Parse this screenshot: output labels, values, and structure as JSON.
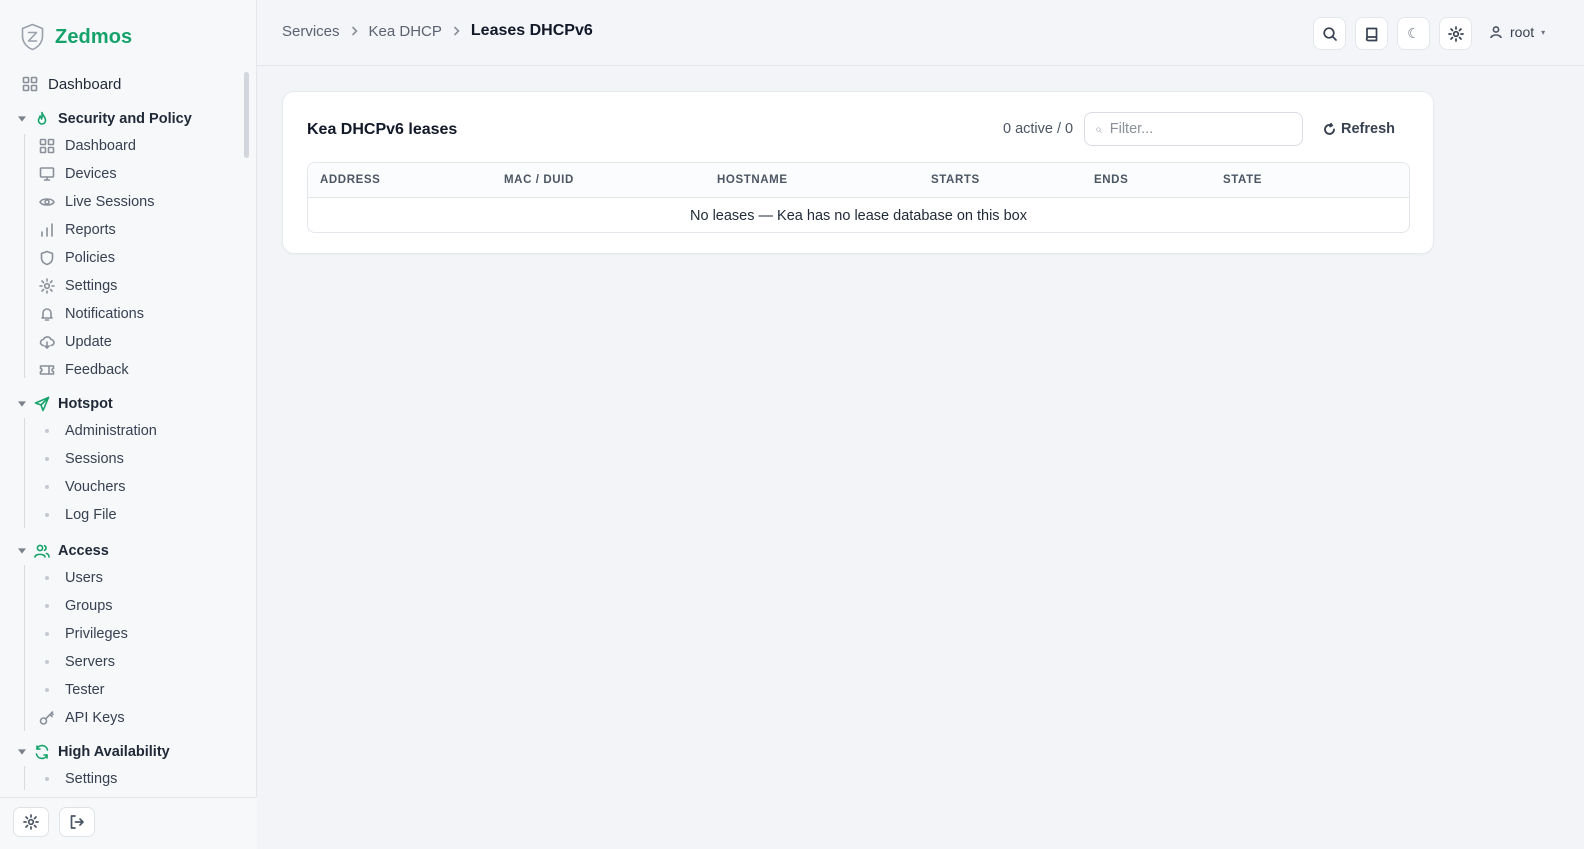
{
  "brand": {
    "name": "Zedmos"
  },
  "sidebar": {
    "top_item": "Dashboard",
    "groups": [
      {
        "title": "Security and Policy",
        "items": [
          "Dashboard",
          "Devices",
          "Live Sessions",
          "Reports",
          "Policies",
          "Settings",
          "Notifications",
          "Update",
          "Feedback"
        ]
      },
      {
        "title": "Hotspot",
        "items": [
          "Administration",
          "Sessions",
          "Vouchers",
          "Log File"
        ]
      },
      {
        "title": "Access",
        "items": [
          "Users",
          "Groups",
          "Privileges",
          "Servers",
          "Tester",
          "API Keys"
        ]
      },
      {
        "title": "High Availability",
        "items": [
          "Settings"
        ]
      }
    ]
  },
  "breadcrumb": {
    "items": [
      "Services",
      "Kea DHCP"
    ],
    "current": "Leases DHCPv6"
  },
  "header": {
    "user": "root"
  },
  "card": {
    "title": "Kea DHCPv6 leases",
    "count": "0 active / 0",
    "filter_placeholder": "Filter...",
    "refresh_label": "Refresh",
    "columns": [
      "ADDRESS",
      "MAC / DUID",
      "HOSTNAME",
      "STARTS",
      "ENDS",
      "STATE"
    ],
    "empty_message": "No leases — Kea has no lease database on this box"
  },
  "colors": {
    "accent": "#16a36b",
    "background": "#f2f4f8"
  }
}
